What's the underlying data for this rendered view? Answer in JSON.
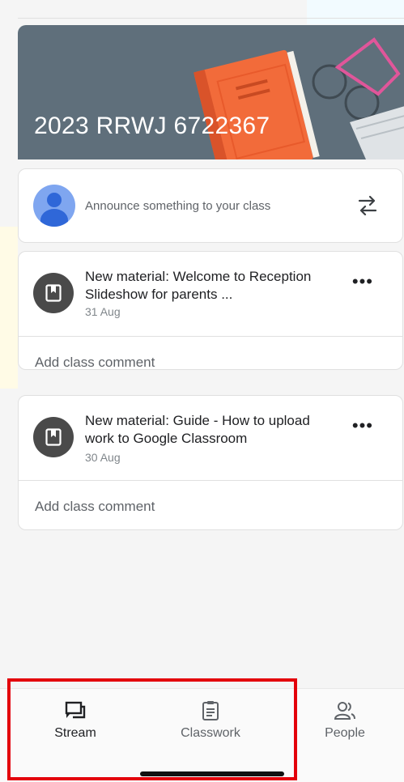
{
  "class": {
    "banner_title": "2023 RRWJ 6722367"
  },
  "announce": {
    "text": "Announce something to your class"
  },
  "posts": [
    {
      "title": "New material: Welcome to Reception Slideshow for parents ...",
      "date": "31 Aug",
      "comment": "Add class comment"
    },
    {
      "title": "New material: Guide - How to upload work to Google Classroom",
      "date": "30 Aug",
      "comment": "Add class comment"
    }
  ],
  "nav": {
    "items": [
      {
        "label": "Stream",
        "icon": "stream-icon",
        "active": true
      },
      {
        "label": "Classwork",
        "icon": "classwork-icon",
        "active": false
      },
      {
        "label": "People",
        "icon": "people-icon",
        "active": false
      }
    ]
  },
  "colors": {
    "banner": "#5f6f7b",
    "book": "#f26b3a",
    "highlight": "#e3000b"
  }
}
